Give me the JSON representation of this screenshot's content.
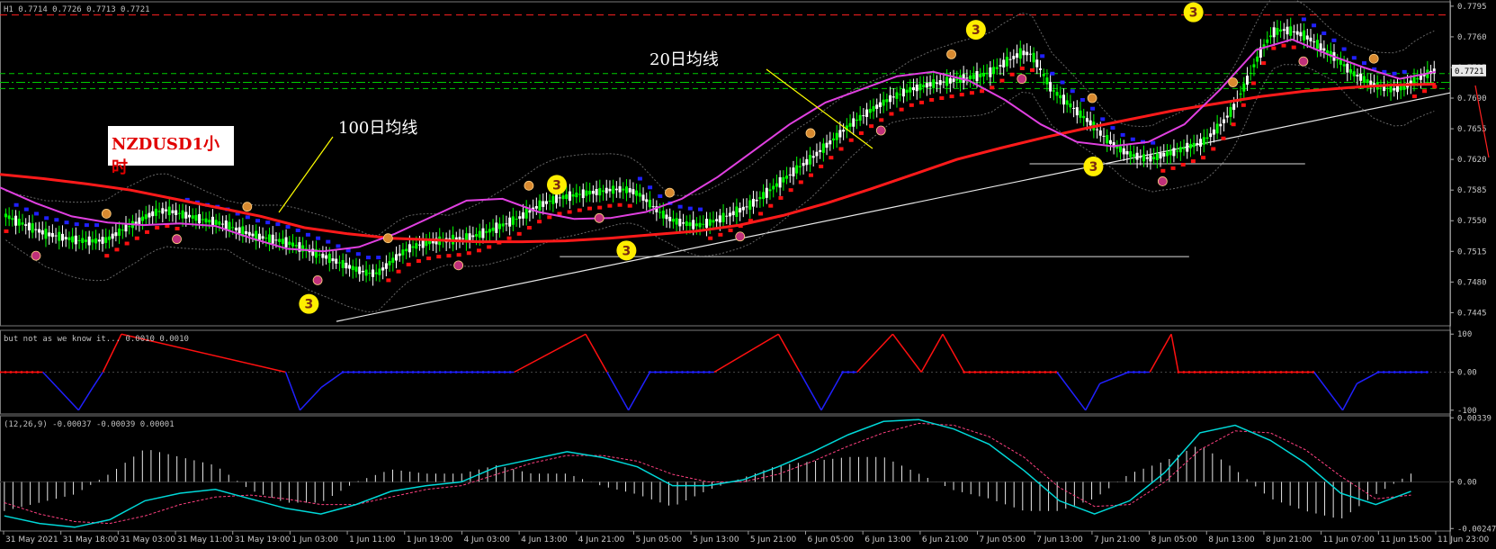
{
  "main_header": "H1  0.7714 0.7726 0.7713 0.7721",
  "annotations": {
    "symbol": "NZDUSD1小时",
    "ma100": "100日均线",
    "ma20": "20日均线"
  },
  "indicator1_header": "but not as we know it...  0.0010 0.0010",
  "indicator2_header": "(12,26,9) -0.00037 -0.00039 0.00001",
  "colors": {
    "ma100": "#ff1a1a",
    "ma20": "#e040e0",
    "bull_candle": "#00ff00",
    "bear_candle": "#ffffff",
    "step_down": "#2020ff",
    "step_up": "#ff1010",
    "signal_marker": "#ffee00",
    "macd_line": "#00d8d8",
    "signal_line": "#ff4080",
    "level_green": "#00cc00",
    "level_red": "#ff2020"
  },
  "chart_data": [
    {
      "type": "line",
      "title": "NZDUSD H1",
      "x_ticks": [
        "31 May 2021",
        "31 May 18:00",
        "31 May 03:00",
        "31 May 11:00",
        "31 May 19:00",
        "1 Jun 03:00",
        "1 Jun 11:00",
        "1 Jun 19:00",
        "4 Jun 03:00",
        "4 Jun 13:00",
        "4 Jun 21:00",
        "5 Jun 05:00",
        "5 Jun 13:00",
        "5 Jun 21:00",
        "6 Jun 05:00",
        "6 Jun 13:00",
        "6 Jun 21:00",
        "7 Jun 05:00",
        "7 Jun 13:00",
        "7 Jun 21:00",
        "8 Jun 05:00",
        "8 Jun 13:00",
        "8 Jun 21:00",
        "11 Jun 07:00",
        "11 Jun 15:00",
        "11 Jun 23:00"
      ],
      "y_ticks": [
        "0.7795",
        "0.7760",
        "0.7725",
        "0.7690",
        "0.7655",
        "0.7620",
        "0.7585",
        "0.7550",
        "0.7515",
        "0.7480",
        "0.7445"
      ],
      "ylim": [
        0.743,
        0.78
      ],
      "current_price": "0.7721",
      "price_levels": [
        0.7785,
        0.7718,
        0.7708,
        0.7701
      ],
      "support_levels": [
        0.7509,
        0.7615
      ],
      "trendline": [
        [
          0.0,
          0.7435
        ],
        [
          1.0,
          0.7696
        ]
      ],
      "close_series": [
        0.7556,
        0.755,
        0.7545,
        0.754,
        0.7535,
        0.7533,
        0.753,
        0.7528,
        0.7527,
        0.7527,
        0.7528,
        0.7535,
        0.7542,
        0.7548,
        0.7555,
        0.756,
        0.7562,
        0.7559,
        0.7556,
        0.7553,
        0.755,
        0.7548,
        0.7545,
        0.754,
        0.7536,
        0.7532,
        0.753,
        0.7528,
        0.7525,
        0.7521,
        0.7516,
        0.7512,
        0.7508,
        0.7503,
        0.7498,
        0.7494,
        0.749,
        0.749,
        0.75,
        0.751,
        0.7518,
        0.7522,
        0.7525,
        0.7527,
        0.7528,
        0.7529,
        0.7531,
        0.7534,
        0.7538,
        0.7543,
        0.7548,
        0.7553,
        0.756,
        0.7567,
        0.7572,
        0.7576,
        0.7578,
        0.758,
        0.7582,
        0.7583,
        0.7585,
        0.7586,
        0.7585,
        0.758,
        0.757,
        0.756,
        0.7552,
        0.7548,
        0.7546,
        0.7545,
        0.7548,
        0.7552,
        0.7557,
        0.7562,
        0.7568,
        0.7576,
        0.7585,
        0.7594,
        0.7603,
        0.7612,
        0.762,
        0.763,
        0.764,
        0.765,
        0.766,
        0.7668,
        0.7676,
        0.7683,
        0.769,
        0.7695,
        0.77,
        0.7703,
        0.7706,
        0.7708,
        0.771,
        0.7712,
        0.7714,
        0.7716,
        0.772,
        0.7728,
        0.7735,
        0.7742,
        0.774,
        0.772,
        0.77,
        0.769,
        0.768,
        0.767,
        0.766,
        0.7648,
        0.7638,
        0.763,
        0.7625,
        0.7622,
        0.7621,
        0.7625,
        0.7628,
        0.7632,
        0.7636,
        0.764,
        0.765,
        0.7662,
        0.7678,
        0.77,
        0.7725,
        0.7748,
        0.7765,
        0.7768,
        0.7766,
        0.7762,
        0.7755,
        0.7746,
        0.7738,
        0.7728,
        0.7718,
        0.7712,
        0.7705,
        0.7702,
        0.77,
        0.7702,
        0.771,
        0.7716,
        0.7721
      ],
      "series": [
        {
          "name": "100日均线",
          "values": [
            0.7603,
            0.7598,
            0.7592,
            0.7585,
            0.7575,
            0.7565,
            0.7555,
            0.7542,
            0.7535,
            0.753,
            0.7528,
            0.7526,
            0.7526,
            0.7527,
            0.753,
            0.7534,
            0.7538,
            0.7545,
            0.7556,
            0.757,
            0.7586,
            0.7603,
            0.762,
            0.7633,
            0.7645,
            0.7656,
            0.7666,
            0.7676,
            0.7684,
            0.7692,
            0.7698,
            0.7702,
            0.7705,
            0.7706
          ]
        },
        {
          "name": "20日均线",
          "values": [
            0.7588,
            0.757,
            0.7555,
            0.7548,
            0.7545,
            0.7547,
            0.7544,
            0.753,
            0.7518,
            0.7515,
            0.752,
            0.7535,
            0.7554,
            0.7573,
            0.7575,
            0.756,
            0.7552,
            0.7553,
            0.756,
            0.7575,
            0.76,
            0.763,
            0.766,
            0.7685,
            0.77,
            0.7715,
            0.772,
            0.771,
            0.7688,
            0.766,
            0.764,
            0.7635,
            0.764,
            0.766,
            0.77,
            0.7745,
            0.7757,
            0.774,
            0.7725,
            0.7712,
            0.772
          ]
        }
      ],
      "signal_markers": [
        {
          "x": 0.213,
          "price": 0.7455,
          "label": "3"
        },
        {
          "x": 0.384,
          "price": 0.7591,
          "label": "3"
        },
        {
          "x": 0.432,
          "price": 0.7516,
          "label": "3"
        },
        {
          "x": 0.673,
          "price": 0.7768,
          "label": "3"
        },
        {
          "x": 0.754,
          "price": 0.7612,
          "label": "3"
        },
        {
          "x": 0.823,
          "price": 0.7788,
          "label": "3"
        }
      ]
    },
    {
      "type": "line",
      "title": "but not as we know it...",
      "y_ticks": [
        "100",
        "0.00",
        "-100"
      ],
      "ylim": [
        -110,
        110
      ],
      "levels_t": [
        0.0,
        0.03,
        0.04,
        0.055,
        0.065,
        0.072,
        0.085,
        0.2,
        0.21,
        0.225,
        0.24,
        0.36,
        0.41,
        0.425,
        0.44,
        0.455,
        0.5,
        0.545,
        0.56,
        0.575,
        0.59,
        0.6,
        0.625,
        0.645,
        0.66,
        0.675,
        0.74,
        0.76,
        0.77,
        0.79,
        0.805,
        0.82,
        0.825,
        0.92,
        0.94,
        0.95,
        0.965,
        1.0
      ],
      "levels_v": [
        0,
        0,
        -40,
        -100,
        -40,
        0,
        100,
        0,
        -100,
        -40,
        0,
        0,
        100,
        0,
        -100,
        0,
        0,
        100,
        0,
        -100,
        0,
        0,
        100,
        0,
        100,
        0,
        0,
        -100,
        -30,
        0,
        0,
        100,
        0,
        0,
        -100,
        -30,
        0,
        0
      ],
      "colors_by_sign": {
        "negative": "blue",
        "positive": "red"
      }
    },
    {
      "type": "line",
      "title": "MACD (12,26,9)",
      "y_ticks": [
        "0.00339",
        "0.00",
        "-0.00247"
      ],
      "ylim": [
        -0.0026,
        0.0035
      ],
      "macd": [
        -0.0018,
        -0.0022,
        -0.0024,
        -0.002,
        -0.001,
        -0.0006,
        -0.0004,
        -0.0009,
        -0.0014,
        -0.0017,
        -0.0012,
        -0.0005,
        -0.0002,
        0.0,
        0.0008,
        0.0012,
        0.0016,
        0.0013,
        0.0008,
        -0.0002,
        -0.0002,
        0.0001,
        0.0008,
        0.0016,
        0.0025,
        0.0032,
        0.0033,
        0.0028,
        0.002,
        0.0006,
        -0.001,
        -0.0017,
        -0.001,
        0.0005,
        0.0026,
        0.003,
        0.0022,
        0.001,
        -0.0006,
        -0.0012,
        -0.0005
      ],
      "signal": [
        -0.0011,
        -0.0017,
        -0.0021,
        -0.0022,
        -0.0018,
        -0.0012,
        -0.0008,
        -0.0007,
        -0.0009,
        -0.0012,
        -0.0012,
        -0.0008,
        -0.0004,
        -0.0002,
        0.0004,
        0.001,
        0.0014,
        0.0014,
        0.0011,
        0.0004,
        0.0,
        0.0,
        0.0004,
        0.0011,
        0.0019,
        0.0026,
        0.0031,
        0.003,
        0.0024,
        0.0013,
        -0.0003,
        -0.0013,
        -0.0012,
        0.0,
        0.0017,
        0.0027,
        0.0026,
        0.0017,
        0.0003,
        -0.0009,
        -0.0007
      ]
    }
  ]
}
